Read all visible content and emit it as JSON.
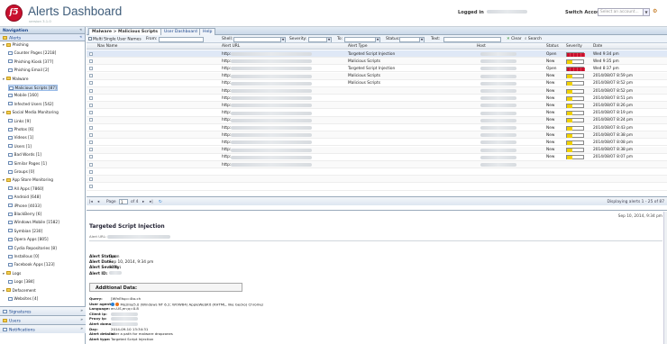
{
  "header": {
    "title": "Alerts Dashboard",
    "subtitle": "version 3.1.0",
    "logged_in_label": "Logged in",
    "switch_account_label": "Switch Account",
    "switch_account_placeholder": "Select an account..."
  },
  "nav": {
    "panel_title": "Navigation",
    "alerts_node": "Alerts",
    "tree": [
      {
        "label": "Phishing",
        "level": 0,
        "type": "folder"
      },
      {
        "label": "Counter Pages [2218]",
        "level": 1,
        "type": "leaf"
      },
      {
        "label": "Phishing Kiosk [377]",
        "level": 1,
        "type": "leaf"
      },
      {
        "label": "Phishing Email [2]",
        "level": 1,
        "type": "leaf"
      },
      {
        "label": "Malware",
        "level": 0,
        "type": "folder"
      },
      {
        "label": "Malicious Scripts [87]",
        "level": 1,
        "type": "leaf",
        "selected": true
      },
      {
        "label": "Mobile [160]",
        "level": 1,
        "type": "leaf"
      },
      {
        "label": "Infected Users [542]",
        "level": 1,
        "type": "leaf"
      },
      {
        "label": "Social Media Monitoring",
        "level": 0,
        "type": "folder"
      },
      {
        "label": "Links [9]",
        "level": 1,
        "type": "leaf"
      },
      {
        "label": "Photos [6]",
        "level": 1,
        "type": "leaf"
      },
      {
        "label": "Videos [1]",
        "level": 1,
        "type": "leaf"
      },
      {
        "label": "Users [1]",
        "level": 1,
        "type": "leaf"
      },
      {
        "label": "Bad Words [1]",
        "level": 1,
        "type": "leaf"
      },
      {
        "label": "Similar Pages [1]",
        "level": 1,
        "type": "leaf"
      },
      {
        "label": "Groups [0]",
        "level": 1,
        "type": "leaf"
      },
      {
        "label": "App Store Monitoring",
        "level": 0,
        "type": "folder"
      },
      {
        "label": "All Apps [7860]",
        "level": 1,
        "type": "leaf"
      },
      {
        "label": "Android [648]",
        "level": 1,
        "type": "leaf"
      },
      {
        "label": "iPhone [4033]",
        "level": 1,
        "type": "leaf"
      },
      {
        "label": "BlackBerry [6]",
        "level": 1,
        "type": "leaf"
      },
      {
        "label": "Windows Mobile [1582]",
        "level": 1,
        "type": "leaf"
      },
      {
        "label": "Symbian [230]",
        "level": 1,
        "type": "leaf"
      },
      {
        "label": "Opera Apps [805]",
        "level": 1,
        "type": "leaf"
      },
      {
        "label": "Cydia Repositories [8]",
        "level": 1,
        "type": "leaf"
      },
      {
        "label": "Installous [0]",
        "level": 1,
        "type": "leaf"
      },
      {
        "label": "Facebook Apps [123]",
        "level": 1,
        "type": "leaf"
      },
      {
        "label": "Logs",
        "level": 0,
        "type": "folder"
      },
      {
        "label": "Logs [384]",
        "level": 1,
        "type": "leaf"
      },
      {
        "label": "Defacement",
        "level": 0,
        "type": "folder"
      },
      {
        "label": "Websites [4]",
        "level": 1,
        "type": "leaf"
      }
    ],
    "bottom_panels": [
      "Signatures",
      "Users",
      "Notifications"
    ]
  },
  "tabs": [
    {
      "label": "Malware > Malicious Scripts",
      "active": true
    },
    {
      "label": "User Dashboard",
      "active": false
    },
    {
      "label": "Help",
      "active": false
    }
  ],
  "filters": {
    "multi_label": "Multi Single User Names",
    "from": "From:",
    "shell": "Shell:",
    "severity": "Severity:",
    "to": "To:",
    "status": "Status:",
    "text": "Text:",
    "clear": "Clear",
    "search": "Search"
  },
  "grid": {
    "columns": [
      "Nav Name",
      "Alert URL",
      "Alert Type",
      "Host",
      "Status",
      "Severity",
      "Date"
    ],
    "rows": [
      {
        "url": "http:",
        "type": "Targeted Script Injection",
        "status": "Open",
        "severity": "high",
        "date": "Wed 9:34 pm",
        "selected": true
      },
      {
        "url": "http:",
        "type": "Malicious Scripts",
        "status": "New",
        "severity": "low",
        "date": "Wed 9:35 pm"
      },
      {
        "url": "http:",
        "type": "Targeted Script Injection",
        "status": "Open",
        "severity": "high",
        "date": "Wed 8:37 pm"
      },
      {
        "url": "http:",
        "type": "Malicious Scripts",
        "status": "New",
        "severity": "low",
        "date": "2014/08/07 8:59 pm"
      },
      {
        "url": "http:",
        "type": "Malicious Scripts",
        "status": "New",
        "severity": "low",
        "date": "2014/08/07 8:52 pm"
      },
      {
        "url": "http:",
        "type": "",
        "status": "New",
        "severity": "low",
        "date": "2014/08/07 8:52 pm"
      },
      {
        "url": "http:",
        "type": "",
        "status": "New",
        "severity": "low",
        "date": "2014/08/07 8:51 pm"
      },
      {
        "url": "http:",
        "type": "",
        "status": "New",
        "severity": "low",
        "date": "2014/08/07 8:26 pm"
      },
      {
        "url": "http:",
        "type": "",
        "status": "New",
        "severity": "low",
        "date": "2014/08/07 8:19 pm"
      },
      {
        "url": "http:",
        "type": "",
        "status": "New",
        "severity": "low",
        "date": "2014/08/07 8:24 pm"
      },
      {
        "url": "http:",
        "type": "",
        "status": "New",
        "severity": "low",
        "date": "2014/08/07 8:43 pm"
      },
      {
        "url": "http:",
        "type": "",
        "status": "New",
        "severity": "low",
        "date": "2014/08/07 8:38 pm"
      },
      {
        "url": "http:",
        "type": "",
        "status": "New",
        "severity": "low",
        "date": "2014/08/07 8:08 pm"
      },
      {
        "url": "http:",
        "type": "",
        "status": "New",
        "severity": "low",
        "date": "2014/08/07 8:38 pm"
      },
      {
        "url": "http:",
        "type": "",
        "status": "New",
        "severity": "low",
        "date": "2014/08/07 8:07 pm"
      },
      {
        "url": "http:",
        "type": "",
        "status": "",
        "severity": "none",
        "date": ""
      },
      {
        "url": "",
        "type": "",
        "status": "",
        "severity": "none",
        "date": ""
      },
      {
        "url": "",
        "type": "",
        "status": "",
        "severity": "none",
        "date": ""
      },
      {
        "url": "",
        "type": "",
        "status": "",
        "severity": "none",
        "date": ""
      }
    ],
    "pager": {
      "page_label": "Page",
      "page": "1",
      "of": "of 4",
      "display": "Displaying alerts 1 - 25 of 87"
    }
  },
  "detail": {
    "title": "Targeted Script Injection",
    "date": "Sep 10, 2014, 9:34 pm",
    "url_label": "Alert URL:",
    "status_label": "Alert Status:",
    "status": "Open",
    "date_label": "Alert Date:",
    "date_value": "Sep 10, 2014, 9:34 pm",
    "severity_label": "Alert Severity:",
    "severity": "81%",
    "id_label": "Alert ID:",
    "additional_title": "Additional Data:",
    "additional": [
      {
        "k": "Query:",
        "v": "[WfnEtsp=4to.ch"
      },
      {
        "k": "User agent:",
        "v": "Mozilla/5.0 (Windows NT 6.2; WOW64) AppleWebKit (KHTML, like Gecko) Chrome/"
      },
      {
        "k": "Language:",
        "v": "en-US,en;q=0.8"
      },
      {
        "k": "Client ip:",
        "v": ""
      },
      {
        "k": "Proxy ip:",
        "v": ""
      },
      {
        "k": "Alert domain:",
        "v": ""
      },
      {
        "k": "Day:",
        "v": "2014-09-10 13:34:31"
      },
      {
        "k": "Alert details:",
        "v": "after a path for malware dropzones"
      },
      {
        "k": "Alert type:",
        "v": "Targeted Script Injection"
      }
    ]
  },
  "colors": {
    "accent": "#15428b",
    "severity_high": "#c8102e",
    "severity_low": "#f0d000",
    "logo": "#c8102e"
  }
}
